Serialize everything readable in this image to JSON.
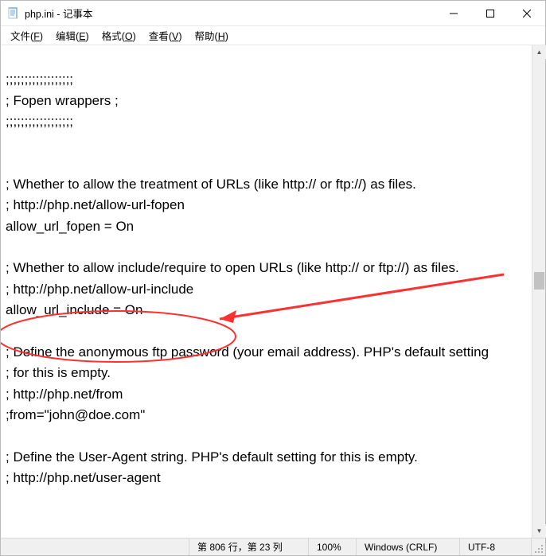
{
  "window": {
    "title": "php.ini - 记事本"
  },
  "menu": {
    "file": {
      "label": "文件",
      "accel": "F"
    },
    "edit": {
      "label": "编辑",
      "accel": "E"
    },
    "format": {
      "label": "格式",
      "accel": "O"
    },
    "view": {
      "label": "查看",
      "accel": "V"
    },
    "help": {
      "label": "帮助",
      "accel": "H"
    }
  },
  "content": {
    "lines": [
      "",
      ";;;;;;;;;;;;;;;;;;",
      "; Fopen wrappers ;",
      ";;;;;;;;;;;;;;;;;;",
      "",
      "",
      "; Whether to allow the treatment of URLs (like http:// or ftp://) as files.",
      "; http://php.net/allow-url-fopen",
      "allow_url_fopen = On",
      "",
      "; Whether to allow include/require to open URLs (like http:// or ftp://) as files.",
      "; http://php.net/allow-url-include",
      "allow_url_include = On",
      "",
      "; Define the anonymous ftp password (your email address). PHP's default setting",
      "; for this is empty.",
      "; http://php.net/from",
      ";from=\"john@doe.com\"",
      "",
      "; Define the User-Agent string. PHP's default setting for this is empty.",
      "; http://php.net/user-agent"
    ]
  },
  "status": {
    "position": "第 806 行，第 23 列",
    "zoom": "100%",
    "eol": "Windows (CRLF)",
    "encoding": "UTF-8"
  },
  "annotation": {
    "color": "#ff3030"
  }
}
